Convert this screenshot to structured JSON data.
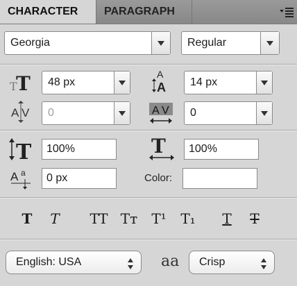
{
  "tabs": [
    {
      "label": "CHARACTER",
      "active": true
    },
    {
      "label": "PARAGRAPH",
      "active": false
    }
  ],
  "font": {
    "family": "Georgia",
    "style": "Regular"
  },
  "size": {
    "value": "48 px",
    "icon": "font-size-icon"
  },
  "leading": {
    "value": "14 px",
    "icon": "leading-icon"
  },
  "kerning": {
    "value": "0",
    "disabled": true,
    "icon": "kerning-icon"
  },
  "tracking": {
    "value": "0",
    "icon": "tracking-icon"
  },
  "vertical_scale": {
    "value": "100%",
    "icon": "vertical-scale-icon"
  },
  "horizontal_scale": {
    "value": "100%",
    "icon": "horizontal-scale-icon"
  },
  "baseline_shift": {
    "value": "0 px",
    "icon": "baseline-shift-icon"
  },
  "color": {
    "label": "Color:",
    "value": "#ffffff"
  },
  "style_buttons": [
    {
      "glyph": "T",
      "name": "faux-bold"
    },
    {
      "glyph": "T",
      "name": "faux-italic"
    },
    {
      "glyph": "TT",
      "name": "all-caps"
    },
    {
      "glyph": "Tт",
      "name": "small-caps"
    },
    {
      "glyph": "T¹",
      "name": "superscript"
    },
    {
      "glyph": "T₁",
      "name": "subscript"
    },
    {
      "glyph": "T",
      "name": "underline"
    },
    {
      "glyph": "T",
      "name": "strikethrough"
    }
  ],
  "language": "English: USA",
  "antialias": {
    "glyph": "aa",
    "value": "Crisp"
  }
}
